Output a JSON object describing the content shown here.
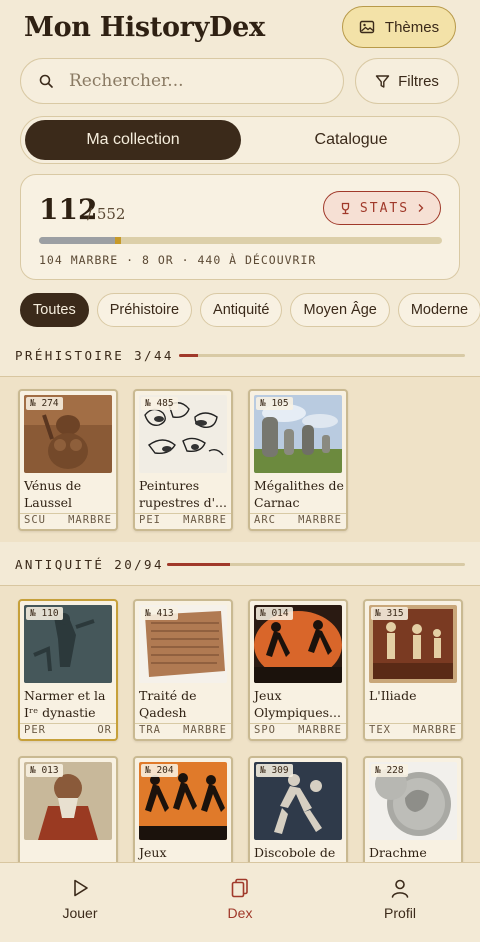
{
  "header": {
    "title": "Mon HistoryDex",
    "themes_label": "Thèmes"
  },
  "search": {
    "placeholder": "Rechercher...",
    "value": "",
    "filters_label": "Filtres"
  },
  "tabs": [
    {
      "label": "Ma collection",
      "active": true
    },
    {
      "label": "Catalogue",
      "active": false
    }
  ],
  "stats": {
    "count": "112",
    "total": "/ 552",
    "button_label": "STATS",
    "summary": "104 MARBRE · 8 OR · 440 À DÉCOUVRIR",
    "marbre_fraction": 0.188,
    "or_fraction": 0.0145
  },
  "filters": [
    {
      "label": "Toutes",
      "active": true
    },
    {
      "label": "Préhistoire",
      "active": false
    },
    {
      "label": "Antiquité",
      "active": false
    },
    {
      "label": "Moyen Âge",
      "active": false
    },
    {
      "label": "Moderne",
      "active": false
    }
  ],
  "sections": [
    {
      "title": "PRÉHISTOIRE",
      "progress_text": "3/44",
      "progress_fraction": 0.068,
      "cards": [
        {
          "number": "№ 274",
          "name": "Vénus de Laussel",
          "code": "SCU",
          "rarity": "MARBRE"
        },
        {
          "number": "№ 485",
          "name": "Peintures rupestres d'...",
          "code": "PEI",
          "rarity": "MARBRE"
        },
        {
          "number": "№ 105",
          "name": "Mégalithes de Carnac",
          "code": "ARC",
          "rarity": "MARBRE"
        }
      ]
    },
    {
      "title": "ANTIQUITÉ",
      "progress_text": "20/94",
      "progress_fraction": 0.213,
      "cards": [
        {
          "number": "№ 110",
          "name": "Narmer et la Iʳᵉ dynastie",
          "code": "PER",
          "rarity": "OR"
        },
        {
          "number": "№ 413",
          "name": "Traité de Qadesh",
          "code": "TRA",
          "rarity": "MARBRE"
        },
        {
          "number": "№ 014",
          "name": "Jeux Olympiques...",
          "code": "SPO",
          "rarity": "MARBRE"
        },
        {
          "number": "№ 315",
          "name": "L'Iliade",
          "code": "TEX",
          "rarity": "MARBRE"
        },
        {
          "number": "№ 013",
          "name": "",
          "code": "",
          "rarity": ""
        },
        {
          "number": "№ 204",
          "name": "Jeux",
          "code": "",
          "rarity": ""
        },
        {
          "number": "№ 309",
          "name": "Discobole de",
          "code": "",
          "rarity": ""
        },
        {
          "number": "№ 228",
          "name": "Drachme",
          "code": "",
          "rarity": ""
        }
      ]
    }
  ],
  "nav": [
    {
      "label": "Jouer",
      "active": false
    },
    {
      "label": "Dex",
      "active": true
    },
    {
      "label": "Profil",
      "active": false
    }
  ],
  "colors": {
    "accent": "#a0392a",
    "dark": "#3b2a1a",
    "background": "#f3ead6",
    "gold": "#c79a2a",
    "marble": "#9c9fa3"
  }
}
